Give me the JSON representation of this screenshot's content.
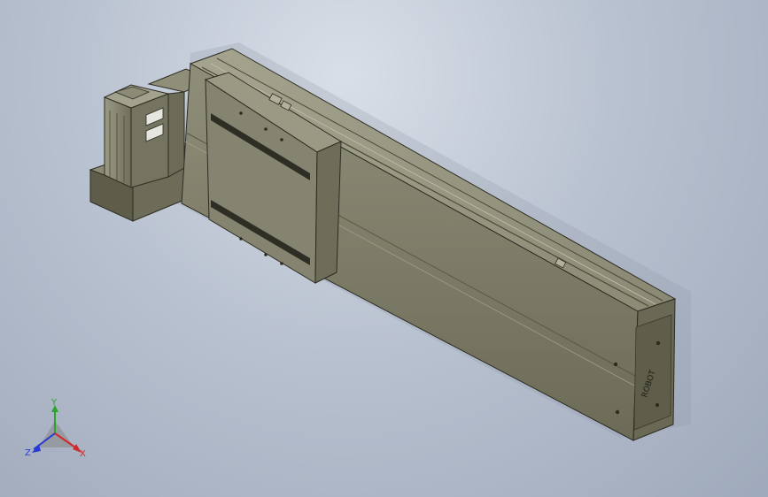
{
  "viewport": {
    "model_name": "linear-actuator-with-stepper-motor",
    "background_top": "#d9dfe8",
    "background_bottom": "#9ea9bb",
    "part_color": "#7e7d6a",
    "part_dark": "#55543f",
    "part_light": "#a6a590",
    "logo_text": "ROBOT"
  },
  "triad": {
    "x_label": "X",
    "y_label": "Y",
    "z_label": "Z",
    "x_color": "#d22a2a",
    "y_color": "#2aa42a",
    "z_color": "#2a3ad2"
  }
}
